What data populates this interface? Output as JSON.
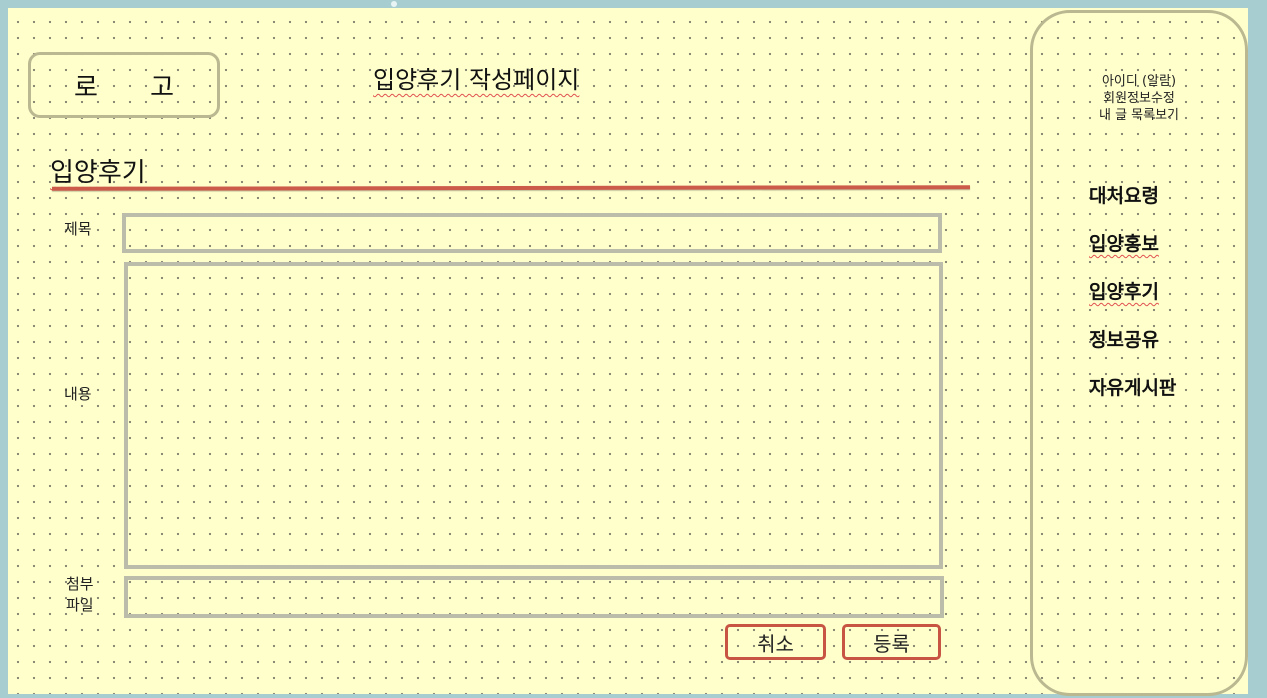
{
  "logo": {
    "label": "로 고"
  },
  "header": {
    "title": "입양후기 작성페이지"
  },
  "section": {
    "heading": "입양후기"
  },
  "form": {
    "title_label": "제목",
    "content_label": "내용",
    "attachment_label_line1": "첨부",
    "attachment_label_line2": "파일",
    "title_value": "",
    "content_value": "",
    "attachment_value": ""
  },
  "buttons": {
    "cancel": "취소",
    "submit": "등록"
  },
  "sidebar": {
    "user_id": "아이디 (알람)",
    "edit_profile": "회원정보수정",
    "my_posts": "내 글 목록보기",
    "nav": [
      {
        "label": "대처요령"
      },
      {
        "label": "입양홍보"
      },
      {
        "label": "입양후기"
      },
      {
        "label": "정보공유"
      },
      {
        "label": "자유게시판"
      }
    ]
  },
  "colors": {
    "page_background": "#ffffcc",
    "frame_border": "#b9b890",
    "accent_red": "#cc5b4a",
    "outer_background": "#a8cdd0"
  }
}
